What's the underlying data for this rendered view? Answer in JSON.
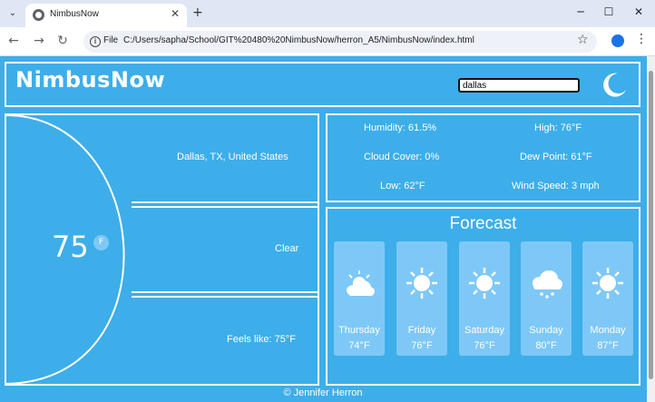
{
  "browser": {
    "tab_title": "NimbusNow",
    "url_chip": "File",
    "url": "C:/Users/sapha/School/GIT%20480%20NimbusNow/herron_A5/NimbusNow/index.html"
  },
  "app": {
    "logo": "NimbusNow",
    "search_value": "dallas"
  },
  "current": {
    "temperature": "75",
    "unit": "F",
    "location": "Dallas, TX, United States",
    "condition": "Clear",
    "feels_like": "Feels like: 75°F"
  },
  "stats": {
    "humidity": "Humidity: 61.5%",
    "high": "High: 76°F",
    "cloud_cover": "Cloud Cover: 0%",
    "dew_point": "Dew Point: 61°F",
    "low": "Low: 62°F",
    "wind_speed": "Wind Speed: 3 mph"
  },
  "forecast": {
    "title": "Forecast",
    "days": [
      {
        "name": "Thursday",
        "temp": "74°F",
        "icon": "partly-cloudy-icon"
      },
      {
        "name": "Friday",
        "temp": "76°F",
        "icon": "sun-icon"
      },
      {
        "name": "Saturday",
        "temp": "76°F",
        "icon": "sun-icon"
      },
      {
        "name": "Sunday",
        "temp": "80°F",
        "icon": "rain-cloud-icon"
      },
      {
        "name": "Monday",
        "temp": "87°F",
        "icon": "sun-icon"
      }
    ]
  },
  "footer": "© Jennifer Herron",
  "colors": {
    "background": "#3daee9",
    "card": "#7ec8f8",
    "border": "#ffffff"
  }
}
